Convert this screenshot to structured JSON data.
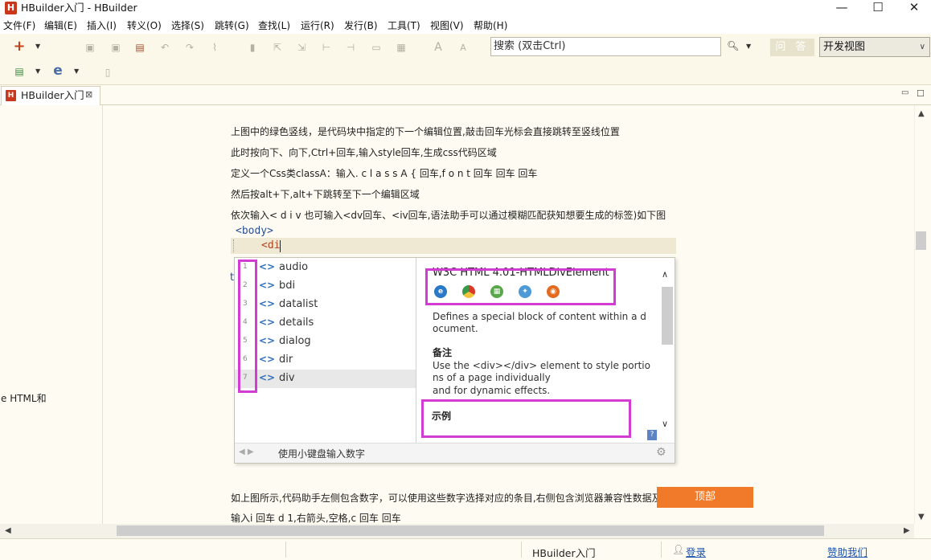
{
  "window": {
    "app_icon": "H",
    "title": "HBuilder入门  -  HBuilder",
    "min": "—",
    "max": "☐",
    "close": "✕"
  },
  "menu": [
    "文件(F)",
    "编辑(E)",
    "插入(I)",
    "转义(O)",
    "选择(S)",
    "跳转(G)",
    "查找(L)",
    "运行(R)",
    "发行(B)",
    "工具(T)",
    "视图(V)",
    "帮助(H)"
  ],
  "toolbar": {
    "search_placeholder": "搜索 (双击Ctrl)",
    "search_icon": "search-icon",
    "qa_button": "问 答",
    "view_select": "开发视图"
  },
  "tab": {
    "icon": "H",
    "label": "HBuilder入门",
    "close": "⊠"
  },
  "left_fragment": "e HTML和",
  "editor": {
    "paragraphs": [
      "上图中的绿色竖线，是代码块中指定的下一个编辑位置,敲击回车光标会直接跳转至竖线位置",
      "此时按向下、向下,Ctrl+回车,输入style回车,生成css代码区域",
      "定义一个Css类classA：输入. c l a s s A { 回车,f o n t 回车 回车 回车",
      "然后按alt+下,alt+下跳转至下一个编辑区域",
      "依次输入< d i v 也可输入<dv回车、<iv回车,语法助手可以通过模糊匹配获知想要生成的标签)如下图"
    ],
    "code_body": "<body>",
    "code_di": "<di",
    "stray_char": "t",
    "after_paragraphs": [
      "如上图所示,代码助手左侧包含数字，可以使用这些数字选择对应的条目,右侧包含浏览器兼容性数据及",
      "输入i 回车 d 1,右箭头,空格,c 回车 回车"
    ]
  },
  "assist": {
    "items": [
      {
        "num": "1",
        "label": "audio"
      },
      {
        "num": "2",
        "label": "bdi"
      },
      {
        "num": "3",
        "label": "datalist"
      },
      {
        "num": "4",
        "label": "details"
      },
      {
        "num": "5",
        "label": "dialog"
      },
      {
        "num": "6",
        "label": "dir"
      },
      {
        "num": "7",
        "label": "div"
      }
    ],
    "selected_index": 6,
    "tag_glyph": "<>",
    "footer_arrows": "◀ ▶",
    "footer_label": "使用小键盘输入数字",
    "detail": {
      "title": "W3C HTML 4.01-HTMLDivElement",
      "browsers": [
        "ie-icon",
        "chrome-icon",
        "android-icon",
        "safari-icon",
        "firefox-icon"
      ],
      "desc_1": "Defines a special block of content within a d",
      "desc_2": "ocument.",
      "note_heading": "备注",
      "note_1": "Use the <div></div> element to style portio",
      "note_2": "ns of a page individually",
      "note_3": "and for dynamic effects.",
      "example_heading": "示例"
    }
  },
  "top_button": "顶部",
  "status": {
    "file": "HBuilder入门",
    "login": "登录",
    "sponsor": "赞助我们"
  }
}
